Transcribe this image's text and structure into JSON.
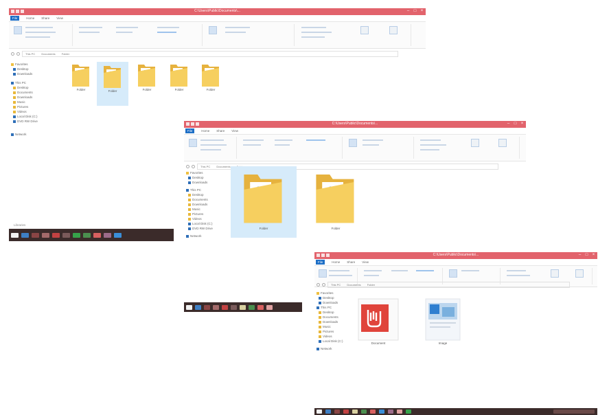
{
  "screenshots": [
    {
      "title": "C:\\Users\\Public\\Documents\\...",
      "tabs": [
        "File",
        "Home",
        "Share",
        "View"
      ],
      "address": [
        "This PC",
        "Documents",
        "Folder"
      ],
      "nav_pane": [
        "Favorites",
        "Desktop",
        "Downloads",
        "This PC",
        "Desktop",
        "Documents",
        "Downloads",
        "Music",
        "Pictures",
        "Videos",
        "Local Disk (C:)",
        "DVD RW Drive",
        "Network"
      ],
      "items": [
        "Folder",
        "Folder",
        "Folder",
        "Folder",
        "Folder"
      ],
      "taskbar_label": "Libraries"
    },
    {
      "title": "C:\\Users\\Public\\Documents\\...",
      "tabs": [
        "File",
        "Home",
        "Share",
        "View"
      ],
      "address": [
        "This PC",
        "Documents",
        "Folder"
      ],
      "nav_pane": [
        "Favorites",
        "Desktop",
        "Downloads",
        "This PC",
        "Desktop",
        "Documents",
        "Downloads",
        "Music",
        "Pictures",
        "Videos",
        "Local Disk (C:)",
        "DVD RW Drive",
        "Network"
      ],
      "items": [
        "Folder",
        "Folder"
      ]
    },
    {
      "title": "C:\\Users\\Public\\Documents\\...",
      "tabs": [
        "File",
        "Home",
        "Share",
        "View"
      ],
      "address": [
        "This PC",
        "Documents",
        "Folder"
      ],
      "nav_pane": [
        "Favorites",
        "Desktop",
        "Downloads",
        "This PC",
        "Desktop",
        "Documents",
        "Downloads",
        "Music",
        "Pictures",
        "Videos",
        "Local Disk (C:)",
        "Network"
      ],
      "items": [
        "Document",
        "Image"
      ]
    }
  ],
  "colors": {
    "titlebar": "#e2636c",
    "file_tab": "#1e6fc6",
    "selection": "#d6ebfa",
    "taskbar": "#3b2b2a",
    "folder": "#f0c24a",
    "pdf_red": "#e0443b"
  },
  "icons": {
    "folder": "folder-icon",
    "pdf": "pdf-file-icon",
    "image": "image-file-icon",
    "drive": "drive-icon"
  }
}
